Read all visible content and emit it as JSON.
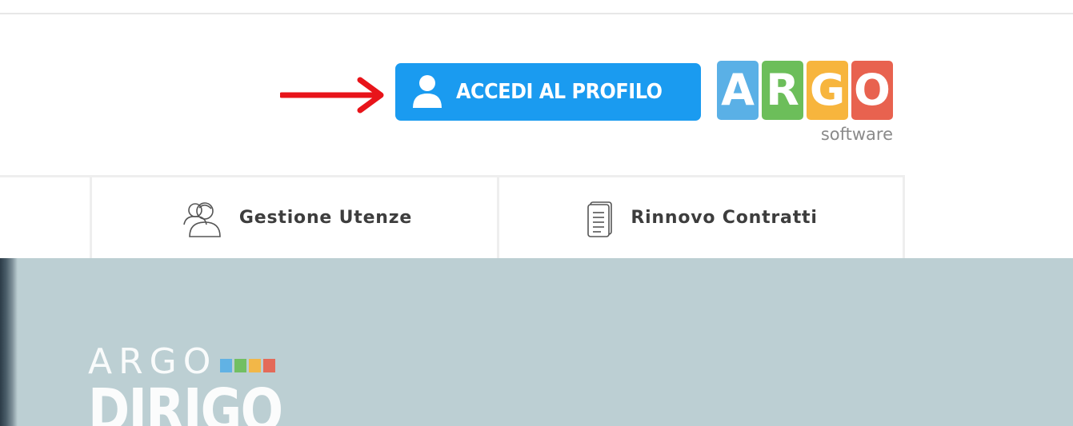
{
  "header": {
    "login_button": {
      "label": "ACCEDI AL PROFILO",
      "icon": "user-icon",
      "color": "#1a9bf0"
    },
    "pointer_arrow": {
      "icon": "arrow-right-icon",
      "color": "#e8141a"
    },
    "brand_logo": {
      "letters": [
        "A",
        "R",
        "G",
        "O"
      ],
      "colors": [
        "#5ab0e6",
        "#6cbe5a",
        "#f7b53d",
        "#e8624f"
      ],
      "subtitle": "software"
    }
  },
  "menu": {
    "items": [
      {
        "label": "Gestione Utenze",
        "icon": "users-icon"
      },
      {
        "label": "Rinnovo Contratti",
        "icon": "document-icon"
      }
    ]
  },
  "banner": {
    "brand": "ARGO",
    "product": "DIRIGO",
    "square_colors": [
      "#5ab0e6",
      "#6cbe5a",
      "#f7b53d",
      "#e8624f"
    ],
    "background": "#bccfd3"
  }
}
